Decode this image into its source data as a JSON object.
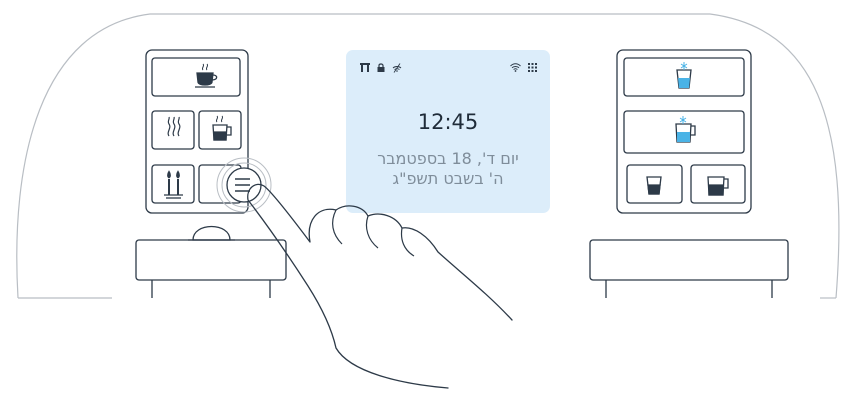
{
  "screen": {
    "status_icons_left": [
      "shabbat-lamp-icon",
      "lock-icon",
      "no-wifi-icon"
    ],
    "status_icons_right": [
      "wifi-icon",
      "grid-icon"
    ],
    "time": "12:45",
    "date_gregorian": "יום ד', 18 בספטמבר",
    "date_hebrew": "ה' בשבט תשפ\"ג"
  },
  "left_panel": {
    "buttons": [
      "hot-coffee-cup-icon",
      "hot-water-steam-icon",
      "hot-jug-icon",
      "shabbat-candles-icon",
      "menu-icon"
    ],
    "active_button": "menu-icon"
  },
  "right_panel": {
    "buttons": [
      "cold-cup-icon",
      "cold-jug-icon",
      "cup-icon",
      "jug-icon"
    ]
  },
  "colors": {
    "outline": "#2d3a48",
    "frame": "#b9bec4",
    "screen_bg": "#dcedfa",
    "screen_text": "#1f2b38",
    "screen_muted": "#7f8d9a",
    "water_accent": "#4ab3e6"
  }
}
